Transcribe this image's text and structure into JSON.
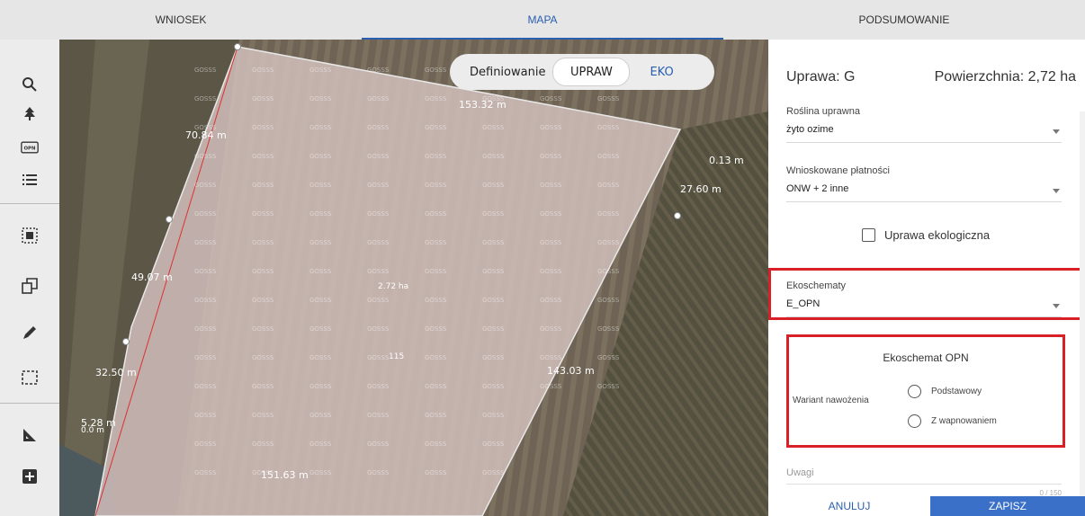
{
  "tabs": [
    {
      "label": "WNIOSEK",
      "active": false
    },
    {
      "label": "MAPA",
      "active": true
    },
    {
      "label": "PODSUMOWANIE",
      "active": false
    }
  ],
  "toolbar": {
    "tools": [
      "search-icon",
      "tree-icon",
      "opn-icon",
      "list-icon",
      "select-area-icon",
      "copy-shape-icon",
      "pencil-icon",
      "dashed-rect-icon",
      "ruler-icon",
      "add-icon"
    ],
    "opn_text": "OPN"
  },
  "map": {
    "toggle_label": "Definiowanie",
    "toggle_on": "UPRAW",
    "toggle_off": "EKO",
    "measurements": [
      "153.32 m",
      "70.84 m",
      "0.13 m",
      "27.60 m",
      "49.07 m",
      "32.50 m",
      "5.28 m",
      "0.0 m",
      "143.03 m",
      "151.63 m",
      "2.72 ha",
      "115"
    ],
    "watermark": "GOSSS"
  },
  "panel": {
    "title": "Uprawa: G",
    "area": "Powierzchnia: 2,72 ha",
    "roslina_label": "Roślina uprawna",
    "roslina_value": "żyto ozime",
    "platnosci_label": "Wnioskowane płatności",
    "platnosci_value": "ONW + 2 inne",
    "ekologiczna_label": "Uprawa ekologiczna",
    "ekoschematy_label": "Ekoschematy",
    "ekoschematy_value": "E_OPN",
    "opn_title": "Ekoschemat OPN",
    "wariant_label": "Wariant nawożenia",
    "option1": "Podstawowy",
    "option2": "Z wapnowaniem",
    "uwagi_label": "Uwagi",
    "counter": "0 / 150",
    "cancel": "ANULUJ",
    "save": "ZAPISZ"
  },
  "colors": {
    "accent": "#2a5fb0",
    "highlight": "#d92027",
    "save_button": "#3a70c8"
  }
}
